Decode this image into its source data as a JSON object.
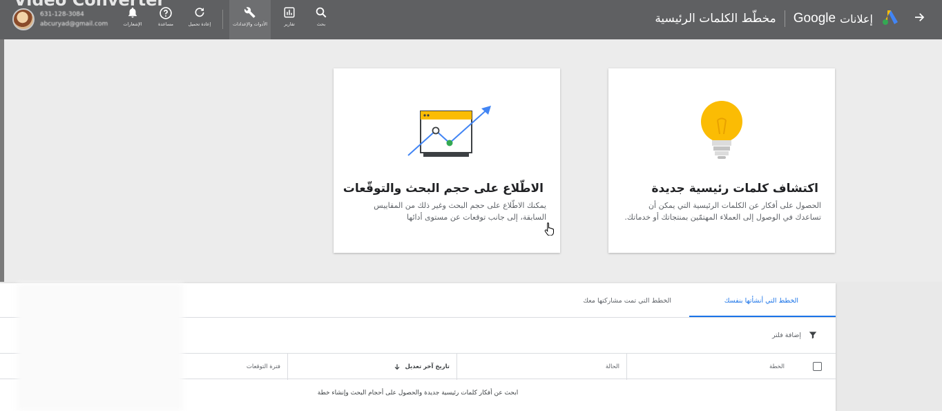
{
  "topbar": {
    "watermark": "Video Converter",
    "account": {
      "phone": "631-128-3084",
      "email": "abcuryad@gmail.com"
    },
    "tools": [
      {
        "icon": "bell-icon",
        "label": "الإشعارات"
      },
      {
        "icon": "help-icon",
        "label": "مساعدة"
      },
      {
        "icon": "refresh-icon",
        "label": "إعادة تحميل"
      },
      {
        "icon": "wrench-icon",
        "label": "الأدوات والإعدادات"
      },
      {
        "icon": "reports-icon",
        "label": "تقارير"
      },
      {
        "icon": "search-icon",
        "label": "بحث"
      }
    ],
    "page_title": "مخطّط الكلمات الرئيسية",
    "brand_google": "Google",
    "brand_ads": "إعلانات"
  },
  "cards": {
    "discover": {
      "title": "اكتشاف كلمات رئيسية جديدة",
      "description": "الحصول على أفكار عن الكلمات الرئيسية التي يمكن أن تساعدك في الوصول إلى العملاء المهتمّين بمنتجاتك أو خدماتك."
    },
    "forecast": {
      "title": "الاطّلاع على حجم البحث والتوقّعات",
      "description": "يمكنك الاطّلاع على حجم البحث وغير ذلك من المقاييس السابقة، إلى جانب توقعات عن مستوى أدائها"
    }
  },
  "plans": {
    "tabs": [
      "الخطط التي أنشأتها بنفسك",
      "الخطط التي تمت مشاركتها معك"
    ],
    "add_filter": "إضافة فلتر",
    "columns": [
      "الخطة",
      "الحالة",
      "تاريخ آخر تعديل",
      "فترة التوقعات"
    ],
    "empty_message": "ابحث عن أفكار كلمات رئيسية جديدة والحصول على أحجام البحث وإنشاء خطة"
  },
  "colors": {
    "topbar": "#5f6062",
    "accent": "#1a73e8",
    "bulb": "#fbbc04",
    "chart_green": "#34a853"
  }
}
